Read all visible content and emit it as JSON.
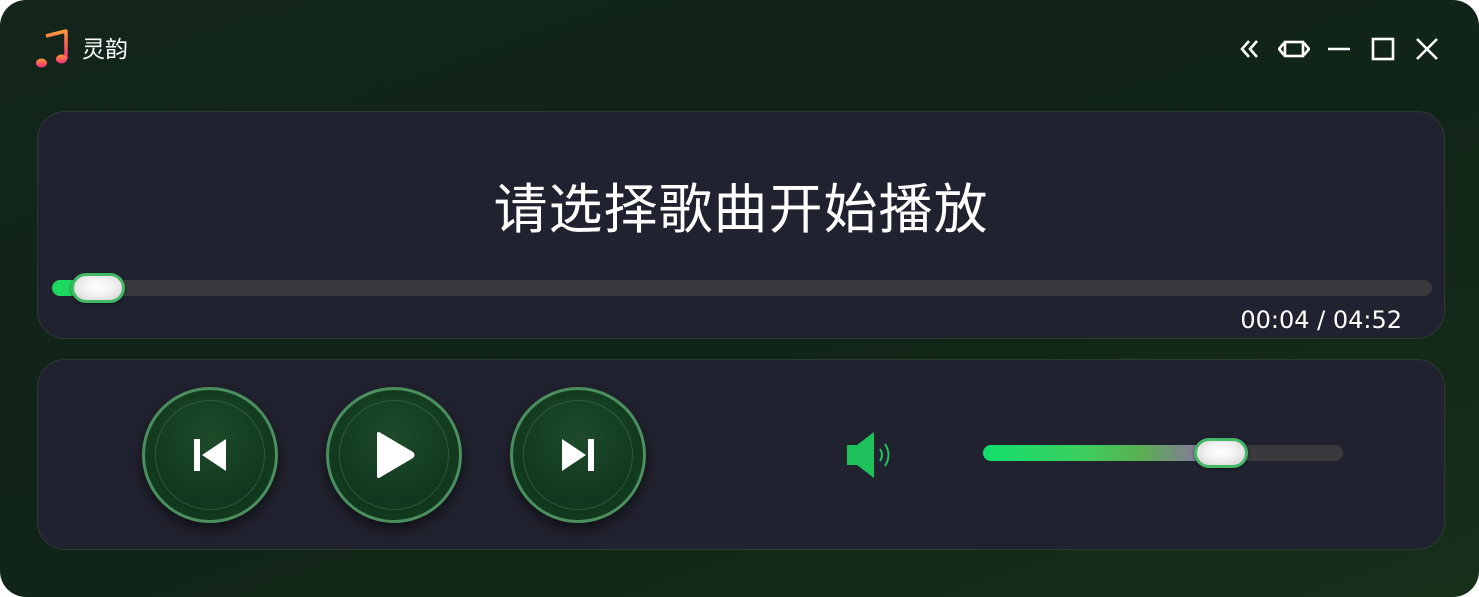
{
  "app": {
    "title": "灵韵",
    "icon": "music-note-icon"
  },
  "window_controls": [
    {
      "name": "collapse-button",
      "icon": "double-chevron-left-icon"
    },
    {
      "name": "mini-mode-button",
      "icon": "expand-horizontal-icon"
    },
    {
      "name": "minimize-button",
      "icon": "minimize-icon"
    },
    {
      "name": "maximize-button",
      "icon": "maximize-icon"
    },
    {
      "name": "close-button",
      "icon": "close-icon"
    }
  ],
  "player": {
    "song_title": "请选择歌曲开始播放",
    "progress_fraction": 0.014,
    "time_display": "00:04 / 04:52"
  },
  "controls": {
    "prev_icon": "skip-previous-icon",
    "play_icon": "play-icon",
    "next_icon": "skip-next-icon",
    "volume_icon": "speaker-icon",
    "volume_fraction": 0.66
  },
  "colors": {
    "accent_green": "#1ed760",
    "panel_bg": "#21222f",
    "window_bg": "#13251a",
    "volume_end_purple": "#9a5fc0"
  }
}
